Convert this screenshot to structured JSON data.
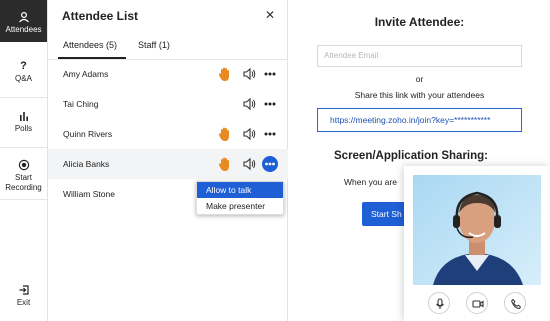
{
  "rail": {
    "items": [
      {
        "label": "Attendees",
        "icon": "attendees-icon"
      },
      {
        "label": "Q&A",
        "icon": "question-icon"
      },
      {
        "label": "Polls",
        "icon": "polls-icon"
      },
      {
        "label": "Start Recording",
        "icon": "record-icon"
      }
    ],
    "exit": {
      "label": "Exit",
      "icon": "exit-icon"
    }
  },
  "panel": {
    "title": "Attendee List",
    "close_icon": "close-icon",
    "tabs": [
      {
        "label": "Attendees (5)"
      },
      {
        "label": "Staff (1)"
      }
    ],
    "attendees": [
      {
        "name": "Amy Adams"
      },
      {
        "name": "Tai Ching"
      },
      {
        "name": "Quinn Rivers"
      },
      {
        "name": "Alicia Banks"
      },
      {
        "name": "William Stone"
      }
    ],
    "menu": [
      "Allow to talk",
      "Make presenter"
    ]
  },
  "main": {
    "invite_title": "Invite Attendee:",
    "email_placeholder": "Attendee Email",
    "or_text": "or",
    "share_text": "Share this link with your attendees",
    "link": "https://meeting.zoho.in/join?key=***********",
    "screen_title": "Screen/Application Sharing:",
    "when_text": "When you are",
    "start_button": "Start Sh"
  },
  "colors": {
    "accent": "#1e5fd6",
    "hand": "#e88a22",
    "rail_active": "#2b2b2b"
  }
}
